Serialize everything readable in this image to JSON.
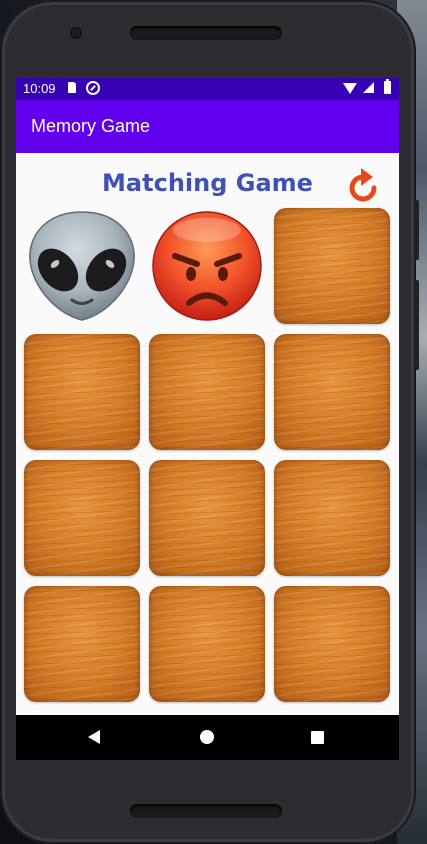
{
  "status_bar": {
    "time": "10:09",
    "icons": [
      "sd-card-icon",
      "sync-icon",
      "wifi-icon",
      "signal-icon",
      "battery-icon"
    ]
  },
  "app_bar": {
    "title": "Memory Game",
    "color": "#6200ee"
  },
  "game": {
    "title": "Matching Game",
    "title_color": "#3f51b5",
    "restart_icon": "restart-icon",
    "cards": [
      {
        "state": "face-up",
        "icon": "alien-icon"
      },
      {
        "state": "face-up",
        "icon": "angry-face-icon"
      },
      {
        "state": "face-down",
        "icon": "wood-card-back"
      },
      {
        "state": "face-down",
        "icon": "wood-card-back"
      },
      {
        "state": "face-down",
        "icon": "wood-card-back"
      },
      {
        "state": "face-down",
        "icon": "wood-card-back"
      },
      {
        "state": "face-down",
        "icon": "wood-card-back"
      },
      {
        "state": "face-down",
        "icon": "wood-card-back"
      },
      {
        "state": "face-down",
        "icon": "wood-card-back"
      },
      {
        "state": "face-down",
        "icon": "wood-card-back"
      },
      {
        "state": "face-down",
        "icon": "wood-card-back"
      },
      {
        "state": "face-down",
        "icon": "wood-card-back"
      }
    ]
  },
  "nav_bar": {
    "buttons": [
      "back",
      "home",
      "recents"
    ]
  }
}
